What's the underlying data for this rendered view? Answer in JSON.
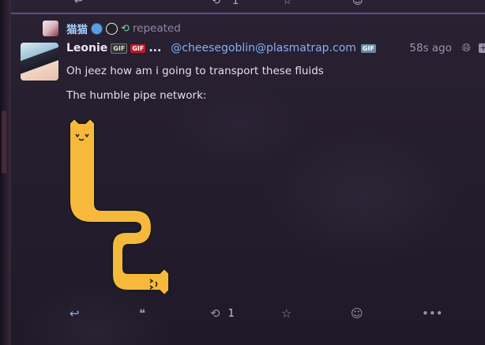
{
  "previous_status": {
    "actions": {
      "boost_count": "1"
    }
  },
  "reblog": {
    "repeater_name": "猫猫",
    "label": "repeated"
  },
  "status": {
    "author_name": "Leonie",
    "badges": [
      "GIF",
      "GIF"
    ],
    "ellipsis": "...",
    "handle": "@cheesegoblin@plasmatrap.com",
    "handle_badge": "GIF",
    "time": "58s ago",
    "content": [
      "Oh jeez how am i going to transport these fluids",
      "The humble pipe network:"
    ],
    "attachment": "long-cat-pipe-image",
    "actions": {
      "boost_count": "1"
    }
  },
  "colors": {
    "accent": "#84aef5",
    "divider": "#5a4f96",
    "cat": "#f6b93b"
  },
  "icons": {
    "reply": "reply-icon",
    "quote": "quote-icon",
    "boost": "boost-icon",
    "favorite": "star-icon",
    "react": "smile-icon",
    "more": "more-icon",
    "visibility": "globe-icon"
  }
}
